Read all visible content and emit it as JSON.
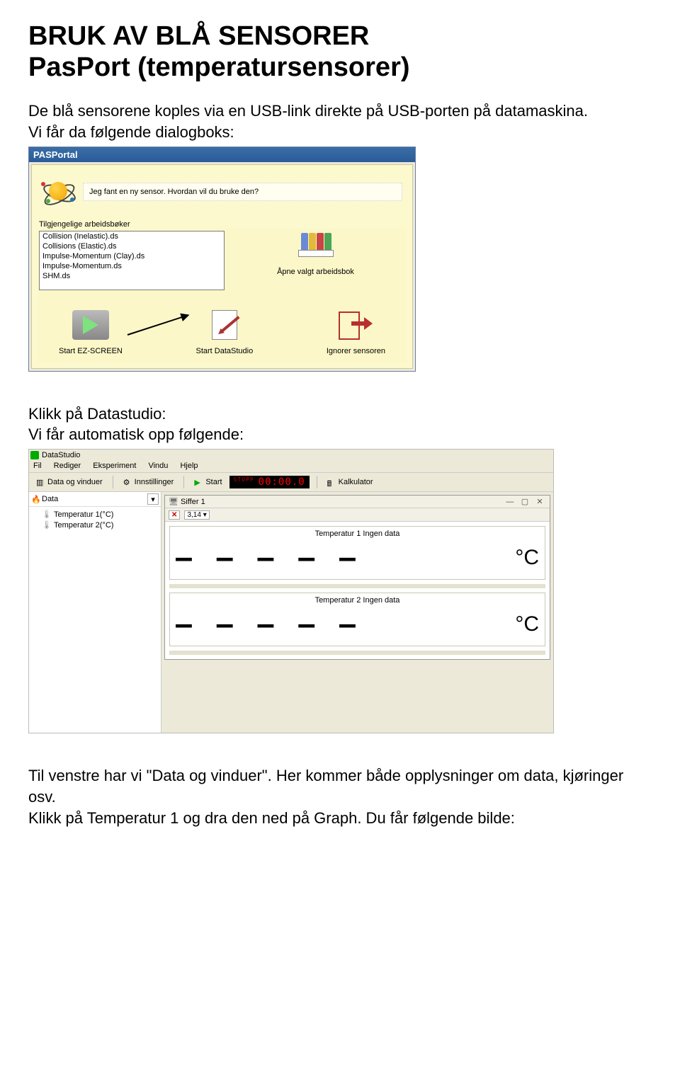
{
  "doc": {
    "title_line1": "BRUK AV BLÅ SENSORER",
    "title_line2": "PasPort (temperatursensorer)",
    "para1": "De blå sensorene koples via en USB-link direkte på USB-porten på datamaskina.",
    "para2": "Vi får da følgende dialogboks:",
    "para3a": "Klikk på Datastudio:",
    "para3b": "Vi får automatisk opp følgende:",
    "para4": "Til venstre har vi \"Data og vinduer\". Her kommer både opplysninger om data, kjøringer osv.",
    "para5": "Klikk på Temperatur 1 og dra den ned på Graph. Du får følgende bilde:"
  },
  "pasportal": {
    "window_title": "PASPortal",
    "prompt": "Jeg fant en ny sensor. Hvordan vil du bruke den?",
    "group_label": "Tilgjengelige arbeidsbøker",
    "workbooks": [
      "Collision (Inelastic).ds",
      "Collisions (Elastic).ds",
      "Impulse-Momentum (Clay).ds",
      "Impulse-Momentum.ds",
      "SHM.ds"
    ],
    "open_workbook": "Åpne valgt arbeidsbok",
    "btn_ez": "Start EZ-SCREEN",
    "btn_ds": "Start DataStudio",
    "btn_ignore": "Ignorer sensoren"
  },
  "datastudio": {
    "app_title": "DataStudio",
    "menu": {
      "fil": "Fil",
      "rediger": "Rediger",
      "eksperiment": "Eksperiment",
      "vindu": "Vindu",
      "hjelp": "Hjelp"
    },
    "toolbar": {
      "data_vinduer": "Data og vinduer",
      "innstillinger": "Innstillinger",
      "start": "Start",
      "stopp": "STOPP",
      "timer": "00:00.0",
      "kalkulator": "Kalkulator"
    },
    "side": {
      "data": "Data",
      "temp1": "Temperatur 1(°C)",
      "temp2": "Temperatur 2(°C)"
    },
    "win": {
      "siffer": "Siffer 1",
      "reading1_label": "Temperatur 1   Ingen data",
      "reading2_label": "Temperatur 2   Ingen data",
      "dashes": "— — — — —",
      "unit": "°C",
      "dropdown": "3,14 ▾"
    }
  }
}
